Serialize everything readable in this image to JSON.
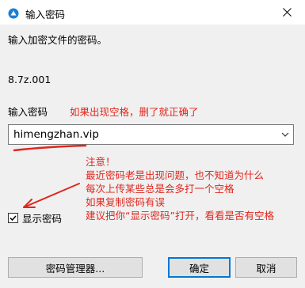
{
  "window": {
    "title": "输入密码",
    "app_icon": "keepass-app-icon",
    "close_icon": "close-icon"
  },
  "dialog": {
    "prompt": "输入加密文件的密码。",
    "filename": "8.7z.001",
    "password_label": "输入密码",
    "password_value": "himengzhan.vip",
    "show_password_label": "显示密码",
    "show_password_checked": true
  },
  "annotations": {
    "hint": "如果出现空格，删了就正确了",
    "note_lines": [
      "注意！",
      "最近密码老是出现问题，也不知道为什么",
      "每次上传某些总是会多打一个空格",
      "如果复制密码有误",
      "建议把你“显示密码”打开，看看是否有空格"
    ],
    "color": "#e0261d"
  },
  "buttons": {
    "manager": "密码管理器...",
    "ok": "确定",
    "cancel": "取消"
  }
}
